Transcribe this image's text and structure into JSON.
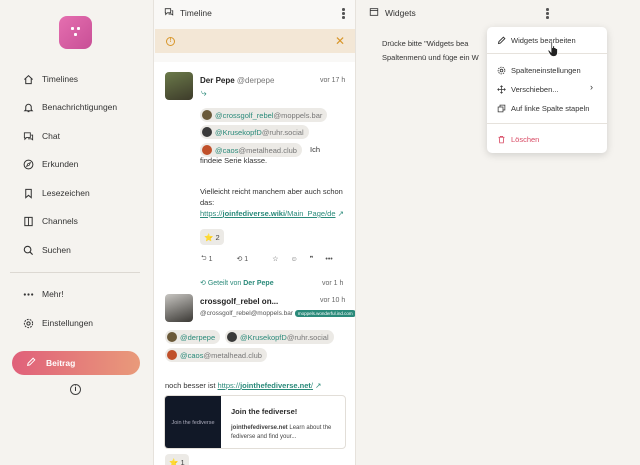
{
  "sidebar": {
    "items": [
      {
        "label": "Timelines",
        "icon": "home-icon"
      },
      {
        "label": "Benachrichtigungen",
        "icon": "bell-icon"
      },
      {
        "label": "Chat",
        "icon": "chat-icon"
      },
      {
        "label": "Erkunden",
        "icon": "compass-icon"
      },
      {
        "label": "Lesezeichen",
        "icon": "bookmark-icon"
      },
      {
        "label": "Channels",
        "icon": "channels-icon"
      },
      {
        "label": "Suchen",
        "icon": "search-icon"
      }
    ],
    "more_label": "Mehr!",
    "settings_label": "Einstellungen",
    "post_label": "Beitrag"
  },
  "timeline": {
    "title": "Timeline",
    "note1": {
      "name": "Der Pepe",
      "handle": "@derpepe",
      "time": "vor 17 h",
      "mentions": [
        {
          "user": "@crossgolf_rebel",
          "domain": "@moppels.bar"
        },
        {
          "user": "@KrusekopfD",
          "domain": "@ruhr.social"
        },
        {
          "user": "@caos",
          "domain": "@metalhead.club"
        }
      ],
      "text_after": "Ich findeie Serie klasse.",
      "text2": "Vielleicht reicht manchem aber auch schon das:",
      "link_prefix": "https://",
      "link_bold": "joinfediverse.wiki",
      "link_rest": "/Main_Page/de",
      "reaction_emoji": "⭐",
      "reaction_count": "2",
      "reply_count": "1",
      "renote_count": "1"
    },
    "boost": {
      "prefix": "Geteilt von",
      "by": "Der Pepe",
      "time": "vor 1 h"
    },
    "note2": {
      "name": "crossgolf_rebel on...",
      "handle": "@crossgolf_rebel",
      "handle_domain": "@moppels.bar",
      "instance_badge": "moppels.wonderful.ind.com",
      "time": "vor 10 h",
      "mentions": [
        {
          "user": "@derpepe",
          "domain": ""
        },
        {
          "user": "@KrusekopfD",
          "domain": "@ruhr.social"
        },
        {
          "user": "@caos",
          "domain": "@metalhead.club"
        }
      ],
      "text": "noch besser ist",
      "link_prefix": "https://",
      "link_bold": "jointhefediverse.net",
      "link_rest": "/",
      "preview": {
        "image_text": "Join the fediverse",
        "title": "Join the fediverse!",
        "site": "jointhefediverse.net",
        "desc": "Learn about the fediverse and find your..."
      },
      "reaction_emoji": "⭐",
      "reaction_count": "1"
    }
  },
  "widgets": {
    "title": "Widgets",
    "hint_line1": "Drücke bitte \"Widgets bea",
    "hint_line2": "Spaltenmenü und füge ein W"
  },
  "menu": {
    "edit_widgets": "Widgets bearbeiten",
    "column_settings": "Spalteneinstellungen",
    "move": "Verschieben...",
    "stack_left": "Auf linke Spalte stapeln",
    "delete": "Löschen"
  },
  "colors": {
    "accent": "#2a8a7a",
    "brand": "#d6579e",
    "danger": "#d84a64",
    "warning": "#d8962a"
  }
}
